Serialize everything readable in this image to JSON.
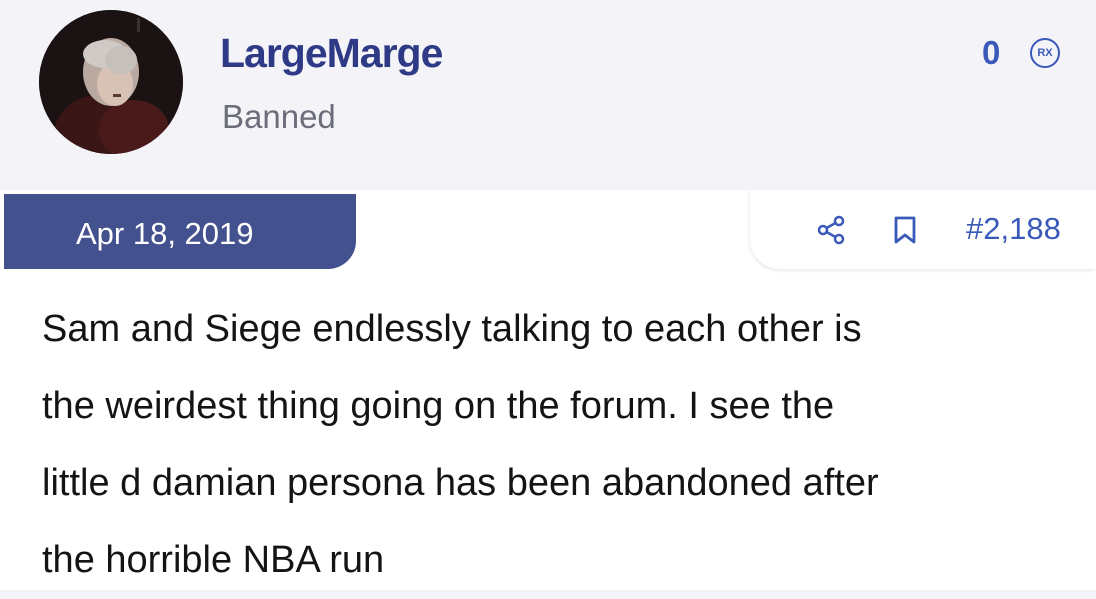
{
  "user": {
    "username": "LargeMarge",
    "title": "Banned",
    "avatar_icon": "user-avatar-photo"
  },
  "reactions": {
    "count": "0",
    "icon_label": "RX"
  },
  "post": {
    "date": "Apr 18, 2019",
    "number": "#2,188",
    "share_icon": "share-icon",
    "bookmark_icon": "bookmark-icon",
    "text": "Sam and Siege endlessly talking to each other is\nthe weirdest thing going on the forum. I see the\nlittle d damian persona has been abandoned after\nthe horrible NBA run"
  },
  "colors": {
    "accent": "#2f3a86",
    "date_tab": "#44518f",
    "link": "#3a59b8",
    "header_bg": "#f4f4f8"
  }
}
